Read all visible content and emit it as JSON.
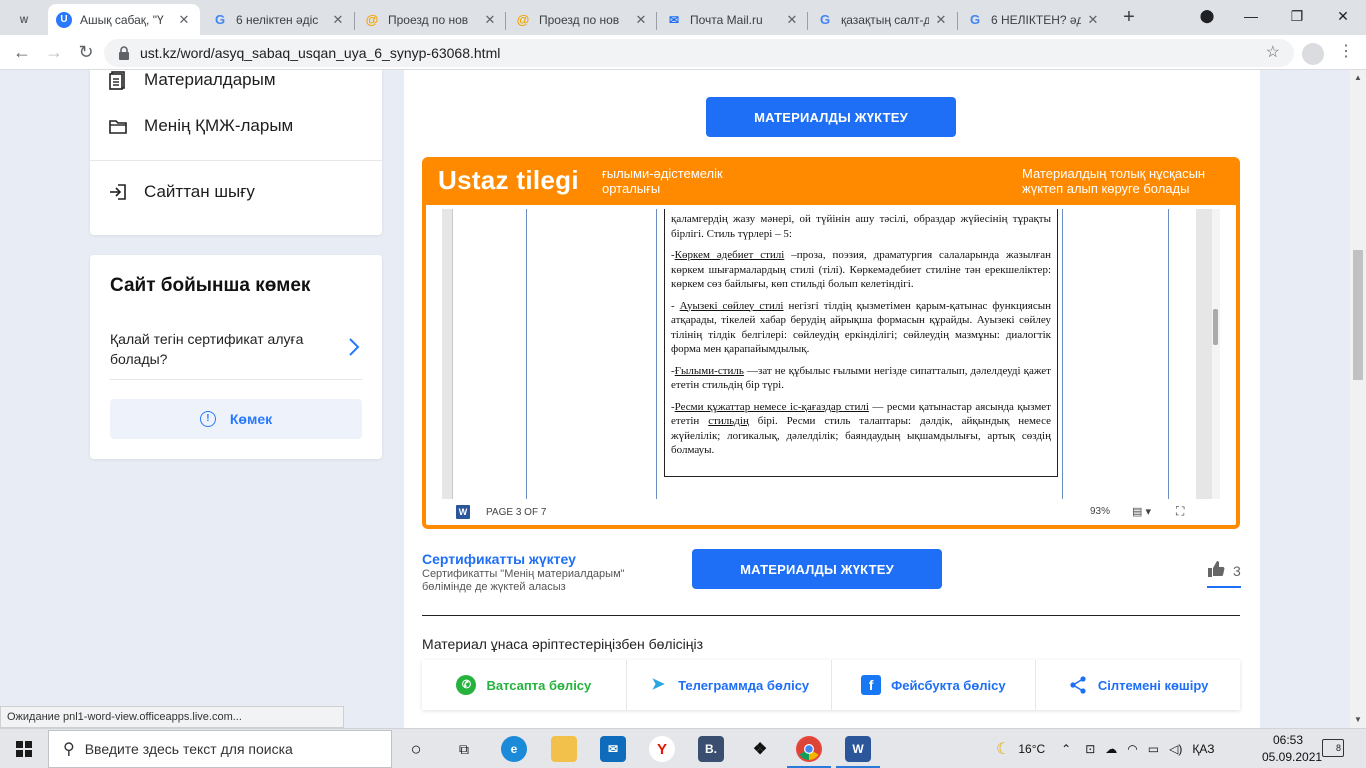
{
  "browser": {
    "tabs": [
      {
        "title": "",
        "favicon_text": "W",
        "favicon_color": "#5f6368"
      },
      {
        "title": "Ашық сабақ, \"Ү",
        "favicon_text": "U",
        "favicon_color": "#2979ff"
      },
      {
        "title": "6 неліктен әдіс",
        "favicon_text": "G",
        "favicon_color": "#4285f4"
      },
      {
        "title": "Проезд по нов",
        "favicon_text": "@",
        "favicon_color": "#f4a300"
      },
      {
        "title": "Проезд по нов",
        "favicon_text": "@",
        "favicon_color": "#f4a300"
      },
      {
        "title": "Почта Mail.ru",
        "favicon_text": "✉",
        "favicon_color": "#1e6ff5"
      },
      {
        "title": "қазақтың салт-д",
        "favicon_text": "G",
        "favicon_color": "#4285f4"
      },
      {
        "title": "6 НЕЛІКТЕН? әд",
        "favicon_text": "G",
        "favicon_color": "#4285f4"
      }
    ],
    "url": "ust.kz/word/asyq_sabaq_usqan_uya_6_synyp-63068.html",
    "new_tab": "+",
    "minimize": "—",
    "maximize": "❐",
    "close": "✕"
  },
  "sidebar": {
    "menu": [
      {
        "label": "Материалдарым",
        "icon": "document-icon"
      },
      {
        "label": "Менің ҚМЖ-ларым",
        "icon": "folder-icon"
      }
    ],
    "logout": {
      "label": "Сайттан шығу",
      "icon": "logout-icon"
    },
    "help": {
      "title": "Сайт бойынша көмек",
      "question": "Қалай тегін сертификат алуға болады?",
      "button_label": "Көмек"
    }
  },
  "main": {
    "download_label": "МАТЕРИАЛДЫ ЖҮКТЕУ",
    "viewer": {
      "brand": "Ustaz tilegi",
      "subtitle": "ғылыми-әдістемелік орталығы",
      "right_text": "Материалдың толық нұсқасын жүктеп алып көруге болады",
      "page_status": "PAGE 3 OF 7",
      "zoom": "93%"
    },
    "document": {
      "p1": "қаламгердің жазу мәнері, ой түйінін ашу тәсілі, образдар жүйесінің тұрақты бірлігі. Стиль түрлері – 5:",
      "p2_u": "Көркем әдебиет стилі",
      "p2": " –проза, поэзия, драматургия салаларында жазылған көркем шығармалардың стилі (тілі). Көркемәдебиет стиліне тән ерекшеліктер: көркем сөз байлығы, көп стильді болып келетіндігі.",
      "p3_u": "Ауызекі сөйлеу стилі",
      "p3": " негізгі тілдің қызметімен қарым-қатынас функциясын атқарады, тікелей хабар берудің айрықша формасын құрайды. Ауызекі сөйлеу тілінің тілдік белгілері: сөйлеудің еркінділігі; сөйлеудің мазмұны: диалогтік форма мен қарапайымдылық.",
      "p4_u": "Ғылыми-стиль",
      "p4": " —зат не құбылыс ғылыми негізде сипатталып, дәлелдеуді қажет ететін стильдің бір түрі.",
      "p5_u": "Ресми құжаттар немесе іс-қағаздар стилі",
      "p5a": " — ресми қатынастар аясында қызмет ететін ",
      "p5_u2": "стильдің",
      "p5b": " бірі. Ресми стиль талаптары: дәлдік, айқындық немесе жүйелілік; логикалық, дәлелділік; баяндаудың ықшамдылығы, артық сөздің болмауы."
    },
    "certificate": {
      "link": "Сертификатты жүктеу",
      "note": "Сертификатты \"Менің материалдарым\" бөлімінде де жүктей аласыз"
    },
    "likes": "3",
    "share": {
      "title": "Материал ұнаса әріптестеріңізбен бөлісіңіз",
      "buttons": [
        {
          "label": "Ватсапта бөлісу",
          "color": "#25b33d",
          "text_color": "#25b33d",
          "glyph": "✆"
        },
        {
          "label": "Телеграммда бөлісу",
          "color": "#2ca5e0",
          "text_color": "#1e6ff5",
          "glyph": "➤"
        },
        {
          "label": "Фейсбукта бөлісу",
          "color": "#1877f2",
          "text_color": "#1e6ff5",
          "glyph": "f"
        },
        {
          "label": "Сілтемені көшіру",
          "color": "#1e6ff5",
          "text_color": "#1e6ff5",
          "glyph": "⋖"
        }
      ]
    }
  },
  "status_text": "Ожидание pnl1-word-view.officeapps.live.com...",
  "taskbar": {
    "search_placeholder": "Введите здесь текст для поиска",
    "weather": "16°C",
    "lang": "ҚАЗ",
    "time": "06:53",
    "date": "05.09.2021",
    "notifications": "8"
  }
}
